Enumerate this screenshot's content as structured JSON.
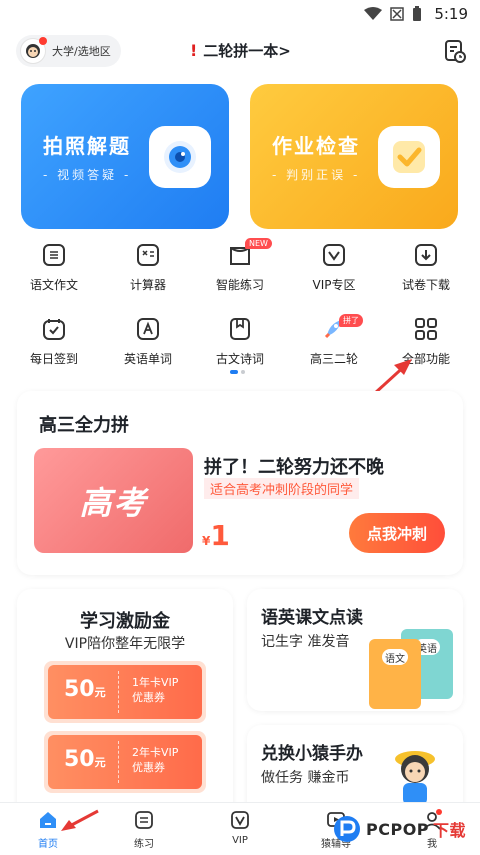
{
  "status_bar": {
    "time": "5:19"
  },
  "header": {
    "region_label": "大学/选地区",
    "title": "二轮拼一本>",
    "title_mark": "!"
  },
  "hero_cards": [
    {
      "title": "拍照解题",
      "subtitle": "- 视频答疑 -",
      "icon": "camera-icon",
      "color": "#2f8ff7"
    },
    {
      "title": "作业检查",
      "subtitle": "- 判别正误 -",
      "icon": "check-icon",
      "color": "#fbb62c"
    }
  ],
  "features": [
    {
      "label": "语文作文",
      "icon": "essay-icon"
    },
    {
      "label": "计算器",
      "icon": "calculator-icon"
    },
    {
      "label": "智能练习",
      "icon": "practice-icon",
      "badge": "NEW"
    },
    {
      "label": "VIP专区",
      "icon": "vip-icon"
    },
    {
      "label": "试卷下载",
      "icon": "download-icon"
    },
    {
      "label": "每日签到",
      "icon": "checkin-icon"
    },
    {
      "label": "英语单词",
      "icon": "english-icon"
    },
    {
      "label": "古文诗词",
      "icon": "poetry-icon"
    },
    {
      "label": "高三二轮",
      "icon": "rocket-icon",
      "badge": "拼了"
    },
    {
      "label": "全部功能",
      "icon": "grid-icon"
    }
  ],
  "promo": {
    "section_title": "高三全力拼",
    "banner_text": "高考",
    "headline": "拼了！二轮努力还不晚",
    "subline": "适合高考冲刺阶段的同学",
    "currency": "¥",
    "price": "1",
    "cta": "点我冲刺"
  },
  "reward": {
    "title": "学习激励金",
    "subtitle": "VIP陪你整年无限学",
    "coupons": [
      {
        "amount": "50",
        "unit": "元",
        "line1": "1年卡VIP",
        "line2": "优惠券"
      },
      {
        "amount": "50",
        "unit": "元",
        "line1": "2年卡VIP",
        "line2": "优惠券"
      }
    ]
  },
  "reading": {
    "title": "语英课文点读",
    "subtitle": "记生字 准发音",
    "book1": "语文",
    "book2": "英语"
  },
  "exchange": {
    "title": "兑换小猿手办",
    "subtitle": "做任务 赚金币"
  },
  "tabs": [
    {
      "label": "首页",
      "icon": "home-icon",
      "active": true
    },
    {
      "label": "练习",
      "icon": "practice-tab-icon",
      "active": false
    },
    {
      "label": "VIP",
      "icon": "vip-tab-icon",
      "active": false
    },
    {
      "label": "猿辅导",
      "icon": "tutor-icon",
      "active": false
    },
    {
      "label": "我",
      "icon": "profile-icon",
      "active": false
    }
  ],
  "watermark": {
    "text1": "PCPOP",
    "text2": "下载"
  },
  "colors": {
    "accent": "#1f7df2",
    "orange": "#ff5a3c",
    "yellow": "#fbb62c"
  }
}
